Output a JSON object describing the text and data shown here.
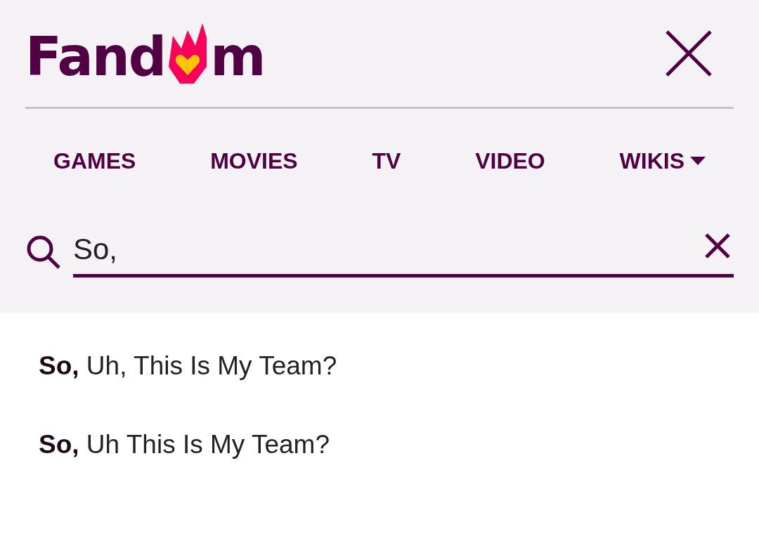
{
  "logo": {
    "before": "Fand",
    "after": "m"
  },
  "nav": [
    {
      "label": "GAMES",
      "dropdown": false
    },
    {
      "label": "MOVIES",
      "dropdown": false
    },
    {
      "label": "TV",
      "dropdown": false
    },
    {
      "label": "VIDEO",
      "dropdown": false
    },
    {
      "label": "WIKIS",
      "dropdown": true
    }
  ],
  "search": {
    "value": "So,"
  },
  "suggestions": [
    "**So,** Uh, This Is My Team?",
    "**So,** Uh This Is My Team?"
  ]
}
